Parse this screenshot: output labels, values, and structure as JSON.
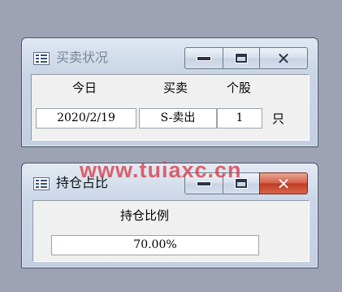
{
  "window_trade": {
    "title": "买卖状况",
    "headers": [
      "今日",
      "买卖",
      "个股"
    ],
    "date_value": "2020/2/19",
    "trade_value": "S-卖出",
    "count_value": "1",
    "unit": "只"
  },
  "window_position": {
    "title": "持仓占比",
    "label": "持仓比例",
    "ratio_value": "70.00%"
  },
  "watermark": "www.tuiaxc.cn",
  "colors": {
    "desktop": "#9da2b4",
    "close_active": "#c94a33",
    "watermark": "#d63c46"
  },
  "icons": [
    "app-form-icon",
    "minimize-icon",
    "maximize-icon",
    "close-icon"
  ]
}
